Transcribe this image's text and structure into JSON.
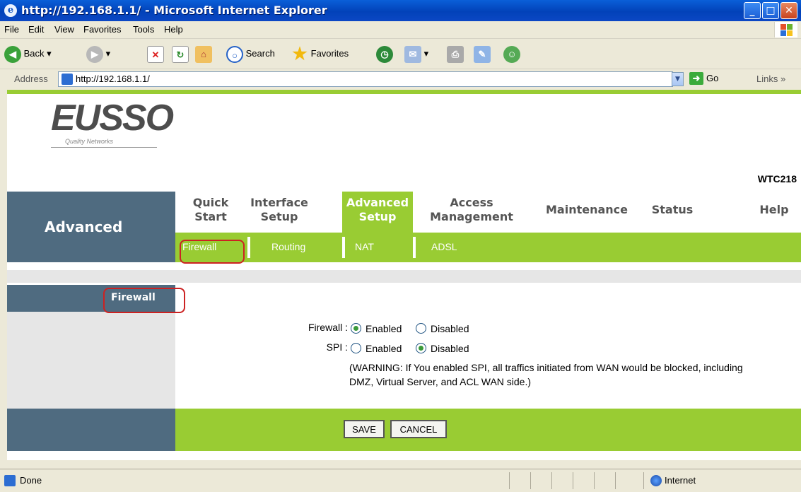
{
  "window": {
    "title": "http://192.168.1.1/ - Microsoft Internet Explorer"
  },
  "menu": [
    "File",
    "Edit",
    "View",
    "Favorites",
    "Tools",
    "Help"
  ],
  "toolbar": {
    "back": "Back",
    "search": "Search",
    "favorites": "Favorites"
  },
  "address": {
    "label": "Address",
    "url": "http://192.168.1.1/",
    "go": "Go",
    "links": "Links"
  },
  "router": {
    "model": "WTC218",
    "logo_text": "EUSSO",
    "logo_tagline": "Quality Networks",
    "section": "Advanced",
    "tabs": [
      {
        "l1": "Quick",
        "l2": "Start"
      },
      {
        "l1": "Interface",
        "l2": "Setup"
      },
      {
        "l1": "Advanced",
        "l2": "Setup"
      },
      {
        "l1": "Access",
        "l2": "Management"
      },
      {
        "l1": "Maintenance",
        "l2": ""
      },
      {
        "l1": "Status",
        "l2": ""
      },
      {
        "l1": "Help",
        "l2": ""
      }
    ],
    "subtabs": [
      "Firewall",
      "Routing",
      "NAT",
      "ADSL"
    ],
    "side_heading": "Firewall",
    "form": {
      "firewall_label": "Firewall :",
      "spi_label": "SPI :",
      "enabled": "Enabled",
      "disabled": "Disabled",
      "firewall_value": "Enabled",
      "spi_value": "Disabled",
      "warning_line1": "(WARNING: If You enabled SPI, all traffics initiated from WAN would be blocked, including",
      "warning_line2": "DMZ, Virtual Server, and ACL WAN side.)"
    },
    "buttons": {
      "save": "SAVE",
      "cancel": "CANCEL"
    }
  },
  "status": {
    "text": "Done",
    "zone": "Internet"
  },
  "colors": {
    "green": "#99cc33",
    "slate": "#4f6b80",
    "highlight": "#cc2222"
  }
}
